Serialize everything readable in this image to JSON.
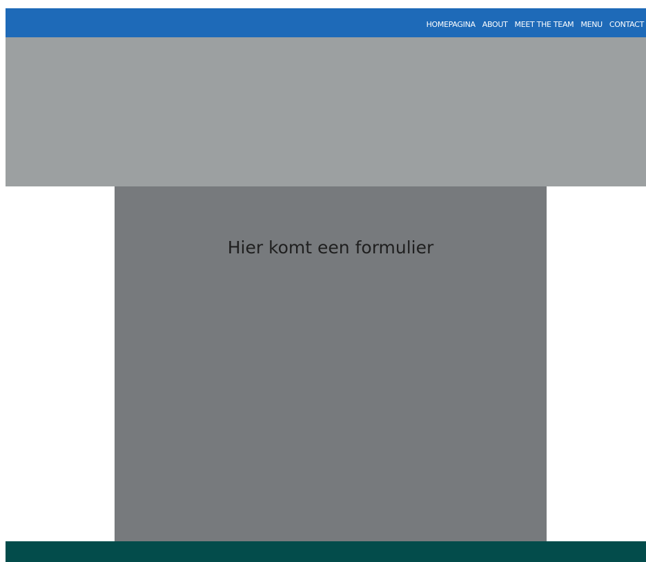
{
  "nav": {
    "items": [
      {
        "label": "HOMEPAGINA"
      },
      {
        "label": "ABOUT"
      },
      {
        "label": "MEET THE TEAM"
      },
      {
        "label": "MENU"
      },
      {
        "label": "CONTACT"
      }
    ]
  },
  "main": {
    "form_placeholder_text": "Hier komt een formulier"
  },
  "colors": {
    "navbar": "#1e6ab8",
    "hero": "#9ca0a1",
    "form_panel": "#777a7d",
    "footer": "#034c4b"
  }
}
